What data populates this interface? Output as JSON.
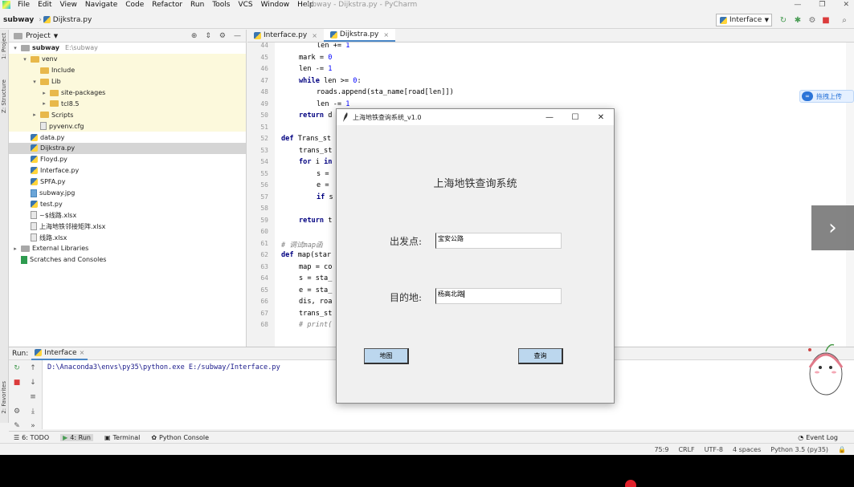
{
  "ide": {
    "menu": [
      "File",
      "Edit",
      "View",
      "Navigate",
      "Code",
      "Refactor",
      "Run",
      "Tools",
      "VCS",
      "Window",
      "Help"
    ],
    "window_title": "subway - Dijkstra.py - PyCharm",
    "breadcrumb": {
      "project": "subway",
      "file": "Dijkstra.py"
    },
    "run_config": "Interface"
  },
  "stripe": {
    "project": "1: Project",
    "structure": "Z: Structure",
    "favorites": "2: Favorites"
  },
  "project": {
    "title": "Project",
    "tree": [
      {
        "label": "subway",
        "extra": "E:\\subway",
        "depth": 0,
        "toggle": "▾",
        "icon": "folder-grey",
        "venv": false
      },
      {
        "label": "venv",
        "extra": "",
        "depth": 1,
        "toggle": "▾",
        "icon": "folder",
        "venv": true
      },
      {
        "label": "Include",
        "extra": "",
        "depth": 2,
        "toggle": "",
        "icon": "folder",
        "venv": true
      },
      {
        "label": "Lib",
        "extra": "",
        "depth": 2,
        "toggle": "▾",
        "icon": "folder",
        "venv": true
      },
      {
        "label": "site-packages",
        "extra": "",
        "depth": 3,
        "toggle": "▸",
        "icon": "folder",
        "venv": true
      },
      {
        "label": "tcl8.5",
        "extra": "",
        "depth": 3,
        "toggle": "▸",
        "icon": "folder",
        "venv": true
      },
      {
        "label": "Scripts",
        "extra": "",
        "depth": 2,
        "toggle": "▸",
        "icon": "folder",
        "venv": true
      },
      {
        "label": "pyvenv.cfg",
        "extra": "",
        "depth": 2,
        "toggle": "",
        "icon": "file",
        "venv": true
      },
      {
        "label": "data.py",
        "extra": "",
        "depth": 1,
        "toggle": "",
        "icon": "py",
        "venv": false
      },
      {
        "label": "Dijkstra.py",
        "extra": "",
        "depth": 1,
        "toggle": "",
        "icon": "py",
        "venv": false,
        "selected": true
      },
      {
        "label": "Floyd.py",
        "extra": "",
        "depth": 1,
        "toggle": "",
        "icon": "py",
        "venv": false
      },
      {
        "label": "Interface.py",
        "extra": "",
        "depth": 1,
        "toggle": "",
        "icon": "py",
        "venv": false
      },
      {
        "label": "SPFA.py",
        "extra": "",
        "depth": 1,
        "toggle": "",
        "icon": "py",
        "venv": false
      },
      {
        "label": "subway.jpg",
        "extra": "",
        "depth": 1,
        "toggle": "",
        "icon": "img",
        "venv": false
      },
      {
        "label": "test.py",
        "extra": "",
        "depth": 1,
        "toggle": "",
        "icon": "py",
        "venv": false
      },
      {
        "label": "~$线路.xlsx",
        "extra": "",
        "depth": 1,
        "toggle": "",
        "icon": "xlsx",
        "venv": false
      },
      {
        "label": "上海地铁邻接矩阵.xlsx",
        "extra": "",
        "depth": 1,
        "toggle": "",
        "icon": "xlsx",
        "venv": false
      },
      {
        "label": "线路.xlsx",
        "extra": "",
        "depth": 1,
        "toggle": "",
        "icon": "xlsx",
        "venv": false
      },
      {
        "label": "External Libraries",
        "extra": "",
        "depth": 0,
        "toggle": "▸",
        "icon": "lib",
        "venv": false
      },
      {
        "label": "Scratches and Consoles",
        "extra": "",
        "depth": 0,
        "toggle": "",
        "icon": "scratch",
        "venv": false
      }
    ]
  },
  "editor": {
    "tabs": [
      {
        "label": "Interface.py",
        "active": false
      },
      {
        "label": "Dijkstra.py",
        "active": true
      }
    ],
    "lines": [
      {
        "n": "44",
        "indent": 2,
        "text": "len += 1"
      },
      {
        "n": "45",
        "indent": 1,
        "text": "mark = 0"
      },
      {
        "n": "46",
        "indent": 1,
        "text": "len -= 1"
      },
      {
        "n": "47",
        "indent": 1,
        "text": "while len >= 0:"
      },
      {
        "n": "48",
        "indent": 2,
        "text": "roads.append(sta_name[road[len]])"
      },
      {
        "n": "49",
        "indent": 2,
        "text": "len -= 1"
      },
      {
        "n": "50",
        "indent": 1,
        "text": "return d"
      },
      {
        "n": "51",
        "indent": 0,
        "text": ""
      },
      {
        "n": "52",
        "indent": 0,
        "text": "def Trans_st"
      },
      {
        "n": "53",
        "indent": 1,
        "text": "trans_st"
      },
      {
        "n": "54",
        "indent": 1,
        "text": "for i in"
      },
      {
        "n": "55",
        "indent": 2,
        "text": "s ="
      },
      {
        "n": "56",
        "indent": 2,
        "text": "e ="
      },
      {
        "n": "57",
        "indent": 2,
        "text": "if s"
      },
      {
        "n": "58",
        "indent": 0,
        "text": ""
      },
      {
        "n": "59",
        "indent": 1,
        "text": "return t"
      },
      {
        "n": "60",
        "indent": 0,
        "text": ""
      },
      {
        "n": "61",
        "indent": 0,
        "text": "# 调试map函"
      },
      {
        "n": "62",
        "indent": 0,
        "text": "def map(star"
      },
      {
        "n": "63",
        "indent": 1,
        "text": "map = co"
      },
      {
        "n": "64",
        "indent": 1,
        "text": "s = sta_"
      },
      {
        "n": "65",
        "indent": 1,
        "text": "e = sta_"
      },
      {
        "n": "66",
        "indent": 1,
        "text": "dis, roa"
      },
      {
        "n": "67",
        "indent": 1,
        "text": "trans_st"
      },
      {
        "n": "68",
        "indent": 1,
        "text": "# print("
      }
    ]
  },
  "run": {
    "label": "Run:",
    "tab": "Interface",
    "output": "D:\\Anaconda3\\envs\\py35\\python.exe E:/subway/Interface.py"
  },
  "bottom_tabs": {
    "todo": "6: TODO",
    "run": "4: Run",
    "terminal": "Terminal",
    "console": "Python Console",
    "event_log": "Event Log"
  },
  "status": {
    "position": "75:9",
    "line_sep": "CRLF",
    "encoding": "UTF-8",
    "indent": "4 spaces",
    "interpreter": "Python 3.5 (py35)"
  },
  "overlay": {
    "baidu_text": "拖拽上传",
    "arrow": "›"
  },
  "tk": {
    "title": "上海地铁查询系统_v1.0",
    "heading": "上海地铁查询系统",
    "start_label": "出发点:",
    "start_value": "宝安公路",
    "end_label": "目的地:",
    "end_value": "杨高北路",
    "map_button": "地图",
    "query_button": "查询"
  }
}
